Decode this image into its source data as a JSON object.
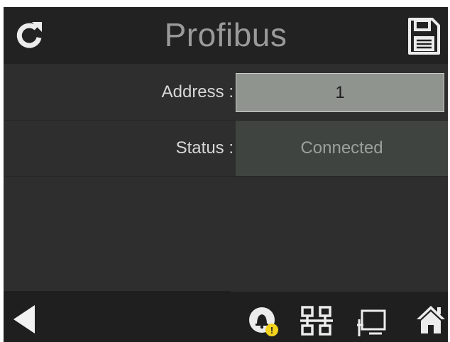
{
  "header": {
    "title": "Profibus",
    "refresh_icon": "refresh-icon",
    "save_icon": "save-icon"
  },
  "fields": {
    "address": {
      "label": "Address :",
      "value": "1"
    },
    "status": {
      "label": "Status :",
      "value": "Connected"
    }
  },
  "footer": {
    "back_icon": "back-arrow-icon",
    "alarm_icon": "bell-icon",
    "alarm_badge": "!",
    "network_icon": "network-icon",
    "display_icon": "monitor-icon",
    "home_icon": "home-icon"
  },
  "colors": {
    "background": "#2e2e2e",
    "header": "#222222",
    "input_bg": "#8f948f",
    "status_bg": "#3f4441",
    "badge": "#f3d21b"
  }
}
